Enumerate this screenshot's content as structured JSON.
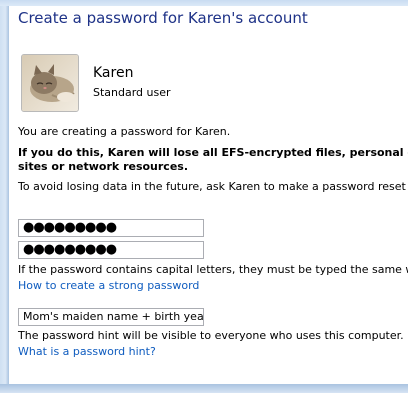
{
  "header": {
    "title": "Create a password for Karen's account"
  },
  "account": {
    "name": "Karen",
    "type": "Standard user",
    "avatar_icon": "kitten-photo-icon"
  },
  "messages": {
    "intro": "You are creating a password for Karen.",
    "warning_line1": "If you do this, Karen will lose all EFS-encrypted files, personal certifi",
    "warning_line2": "sites or network resources.",
    "advice": "To avoid losing data in the future, ask Karen to make a password reset f"
  },
  "form": {
    "new_password_value": "●●●●●●●●●",
    "confirm_password_value": "●●●●●●●●●",
    "caps_note": "If the password contains capital letters, they must be typed the same w",
    "strong_password_link": "How to create a strong password",
    "hint_value": "Mom's maiden name + birth year",
    "hint_note": "The password hint will be visible to everyone who uses this computer.",
    "hint_link": "What is a password hint?"
  }
}
